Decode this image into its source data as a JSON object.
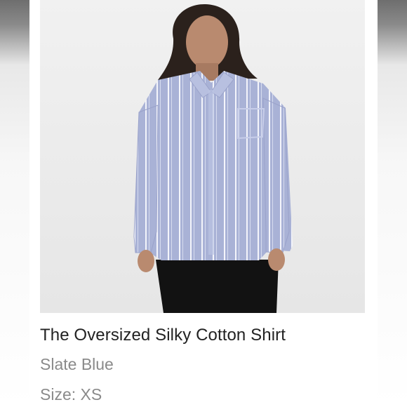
{
  "product": {
    "title": "The Oversized Silky Cotton Shirt",
    "color": "Slate Blue",
    "size": "Size: XS",
    "image_alt": "Model wearing oversized slate blue striped shirt with black pants"
  },
  "colors": {
    "shirt": "#a9b2d6",
    "stripe": "#f4f5fb",
    "pants": "#121212",
    "background": "#ececec",
    "title": "#222222",
    "meta": "#8a8a8a"
  }
}
